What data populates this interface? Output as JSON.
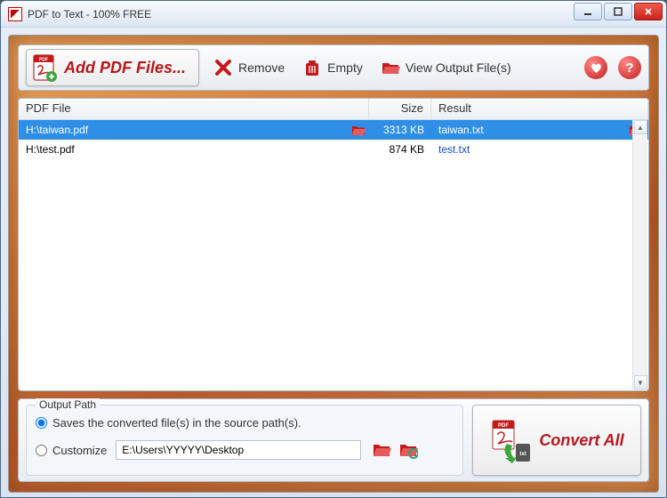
{
  "window": {
    "title": "PDF to Text - 100% FREE"
  },
  "toolbar": {
    "add_label": "Add PDF Files...",
    "remove_label": "Remove",
    "empty_label": "Empty",
    "view_output_label": "View Output File(s)"
  },
  "columns": {
    "file": "PDF File",
    "size": "Size",
    "result": "Result"
  },
  "files": [
    {
      "path": "H:\\taiwan.pdf",
      "size": "3313 KB",
      "result": "taiwan.txt",
      "selected": true
    },
    {
      "path": "H:\\test.pdf",
      "size": "874 KB",
      "result": "test.txt",
      "selected": false
    }
  ],
  "output": {
    "legend": "Output Path",
    "save_source_label": "Saves the converted file(s) in the source path(s).",
    "customize_label": "Customize",
    "custom_path": "E:\\Users\\YYYYY\\Desktop",
    "selected": "source"
  },
  "convert": {
    "label": "Convert All"
  }
}
